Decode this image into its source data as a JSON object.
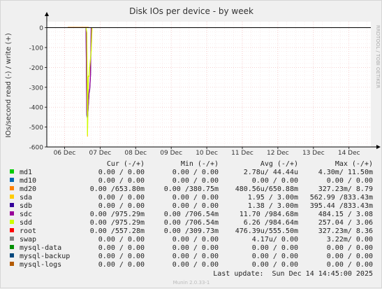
{
  "chart_data": {
    "type": "line",
    "title": "Disk IOs per device - by week",
    "ylabel": "IOs/second read (-) / write (+)",
    "xlabel": "",
    "ylim": [
      -600,
      30
    ],
    "yticks": [
      0,
      -100,
      -200,
      -300,
      -400,
      -500,
      -600
    ],
    "ytick_labels": [
      "0",
      "-100",
      "-200",
      "-300",
      "-400",
      "-500",
      "-600"
    ],
    "xlim": [
      "2025-12-05T12:00",
      "2025-12-14T14:45"
    ],
    "xtick_labels": [
      "06 Dec",
      "07 Dec",
      "08 Dec",
      "09 Dec",
      "10 Dec",
      "11 Dec",
      "12 Dec",
      "13 Dec",
      "14 Dec"
    ],
    "xticks": [
      "2025-12-06",
      "2025-12-07",
      "2025-12-08",
      "2025-12-09",
      "2025-12-10",
      "2025-12-11",
      "2025-12-12",
      "2025-12-13",
      "2025-12-14"
    ],
    "grid": true,
    "series": [
      {
        "name": "md1",
        "color": "#00cc00",
        "points": []
      },
      {
        "name": "md10",
        "color": "#0066b3",
        "points": []
      },
      {
        "name": "md20",
        "color": "#ff8000",
        "points": []
      },
      {
        "name": "sda",
        "color": "#ffcc00",
        "points": [
          [
            "2025-12-06T14:30",
            0
          ],
          [
            "2025-12-06T15:00",
            -30
          ],
          [
            "2025-12-06T15:30",
            -548
          ],
          [
            "2025-12-06T16:00",
            -248
          ],
          [
            "2025-12-06T16:30",
            -245
          ],
          [
            "2025-12-06T17:00",
            -200
          ],
          [
            "2025-12-06T17:30",
            -160
          ],
          [
            "2025-12-06T18:00",
            -120
          ],
          [
            "2025-12-06T18:30",
            0
          ]
        ]
      },
      {
        "name": "sdb",
        "color": "#330099",
        "points": [
          [
            "2025-12-06T14:30",
            0
          ],
          [
            "2025-12-06T15:00",
            -440
          ],
          [
            "2025-12-06T15:30",
            -458
          ],
          [
            "2025-12-06T16:00",
            -400
          ],
          [
            "2025-12-06T16:30",
            -330
          ],
          [
            "2025-12-06T17:00",
            -310
          ],
          [
            "2025-12-06T17:30",
            -240
          ],
          [
            "2025-12-06T18:00",
            0
          ]
        ]
      },
      {
        "name": "sdc",
        "color": "#990099",
        "points": [
          [
            "2025-12-06T14:30",
            0
          ],
          [
            "2025-12-06T15:00",
            -420
          ],
          [
            "2025-12-06T15:30",
            -455
          ],
          [
            "2025-12-06T16:00",
            -395
          ],
          [
            "2025-12-06T16:30",
            -325
          ],
          [
            "2025-12-06T17:00",
            -305
          ],
          [
            "2025-12-06T17:30",
            -235
          ],
          [
            "2025-12-06T18:00",
            0
          ]
        ]
      },
      {
        "name": "sdd",
        "color": "#ccff00",
        "points": [
          [
            "2025-12-06T14:30",
            0
          ],
          [
            "2025-12-06T15:00",
            -25
          ],
          [
            "2025-12-06T15:30",
            -540
          ],
          [
            "2025-12-06T16:00",
            -245
          ],
          [
            "2025-12-06T16:30",
            -240
          ],
          [
            "2025-12-06T17:00",
            -195
          ],
          [
            "2025-12-06T17:30",
            -155
          ],
          [
            "2025-12-06T18:00",
            -115
          ],
          [
            "2025-12-06T18:30",
            0
          ]
        ]
      },
      {
        "name": "root",
        "color": "#ff0000",
        "points": []
      },
      {
        "name": "swap",
        "color": "#808080",
        "points": []
      },
      {
        "name": "mysql-data",
        "color": "#008f00",
        "points": []
      },
      {
        "name": "mysql-backup",
        "color": "#00487d",
        "points": []
      },
      {
        "name": "mysql-logs",
        "color": "#b35a00",
        "points": []
      }
    ]
  },
  "side_label": "RRDTOOL / TOBI OETIKER",
  "table": {
    "headers": {
      "cur": "Cur (-/+)",
      "min": "Min (-/+)",
      "avg": "Avg (-/+)",
      "max": "Max (-/+)"
    },
    "rows": [
      {
        "name": "md1",
        "color": "#00cc00",
        "cur": "0.00 /  0.00",
        "min": "0.00 /  0.00",
        "avg": "2.78u/ 44.44u",
        "max": "4.30m/ 11.50m"
      },
      {
        "name": "md10",
        "color": "#0066b3",
        "cur": "0.00 /  0.00",
        "min": "0.00 /  0.00",
        "avg": "0.00 /  0.00",
        "max": "0.00 /  0.00"
      },
      {
        "name": "md20",
        "color": "#ff8000",
        "cur": "0.00 /653.80m",
        "min": "0.00 /380.75m",
        "avg": "480.56u/650.88m",
        "max": "327.23m/  8.79"
      },
      {
        "name": "sda",
        "color": "#ffcc00",
        "cur": "0.00 /  0.00",
        "min": "0.00 /  0.00",
        "avg": "1.95 /  3.00m",
        "max": "562.99 /833.43m"
      },
      {
        "name": "sdb",
        "color": "#330099",
        "cur": "0.00 /  0.00",
        "min": "0.00 /  0.00",
        "avg": "1.38 /  3.00m",
        "max": "395.44 /833.43m"
      },
      {
        "name": "sdc",
        "color": "#990099",
        "cur": "0.00 /975.29m",
        "min": "0.00 /706.54m",
        "avg": "11.70 /984.68m",
        "max": "484.15 /  3.08"
      },
      {
        "name": "sdd",
        "color": "#ccff00",
        "cur": "0.00 /975.29m",
        "min": "0.00 /706.54m",
        "avg": "6.26 /984.64m",
        "max": "257.04 /  3.06"
      },
      {
        "name": "root",
        "color": "#ff0000",
        "cur": "0.00 /557.28m",
        "min": "0.00 /309.73m",
        "avg": "476.39u/555.50m",
        "max": "327.23m/  8.36"
      },
      {
        "name": "swap",
        "color": "#808080",
        "cur": "0.00 /  0.00",
        "min": "0.00 /  0.00",
        "avg": "4.17u/  0.00",
        "max": "3.22m/  0.00"
      },
      {
        "name": "mysql-data",
        "color": "#008f00",
        "cur": "0.00 /  0.00",
        "min": "0.00 /  0.00",
        "avg": "0.00 /  0.00",
        "max": "0.00 /  0.00"
      },
      {
        "name": "mysql-backup",
        "color": "#00487d",
        "cur": "0.00 /  0.00",
        "min": "0.00 /  0.00",
        "avg": "0.00 /  0.00",
        "max": "0.00 /  0.00"
      },
      {
        "name": "mysql-logs",
        "color": "#b35a00",
        "cur": "0.00 /  0.00",
        "min": "0.00 /  0.00",
        "avg": "0.00 /  0.00",
        "max": "0.00 /  0.00"
      }
    ]
  },
  "last_update": "Last update:  Sun Dec 14 14:45:00 2025",
  "footer": "Munin 2.0.33-1",
  "colors": {
    "background": "#f0f0f0",
    "plot": "#ffffff",
    "grid_major": "#f2b5b5",
    "grid_minor": "#f5dcdc",
    "axis": "#000000",
    "text": "#000000",
    "muted": "#aaaaaa"
  }
}
